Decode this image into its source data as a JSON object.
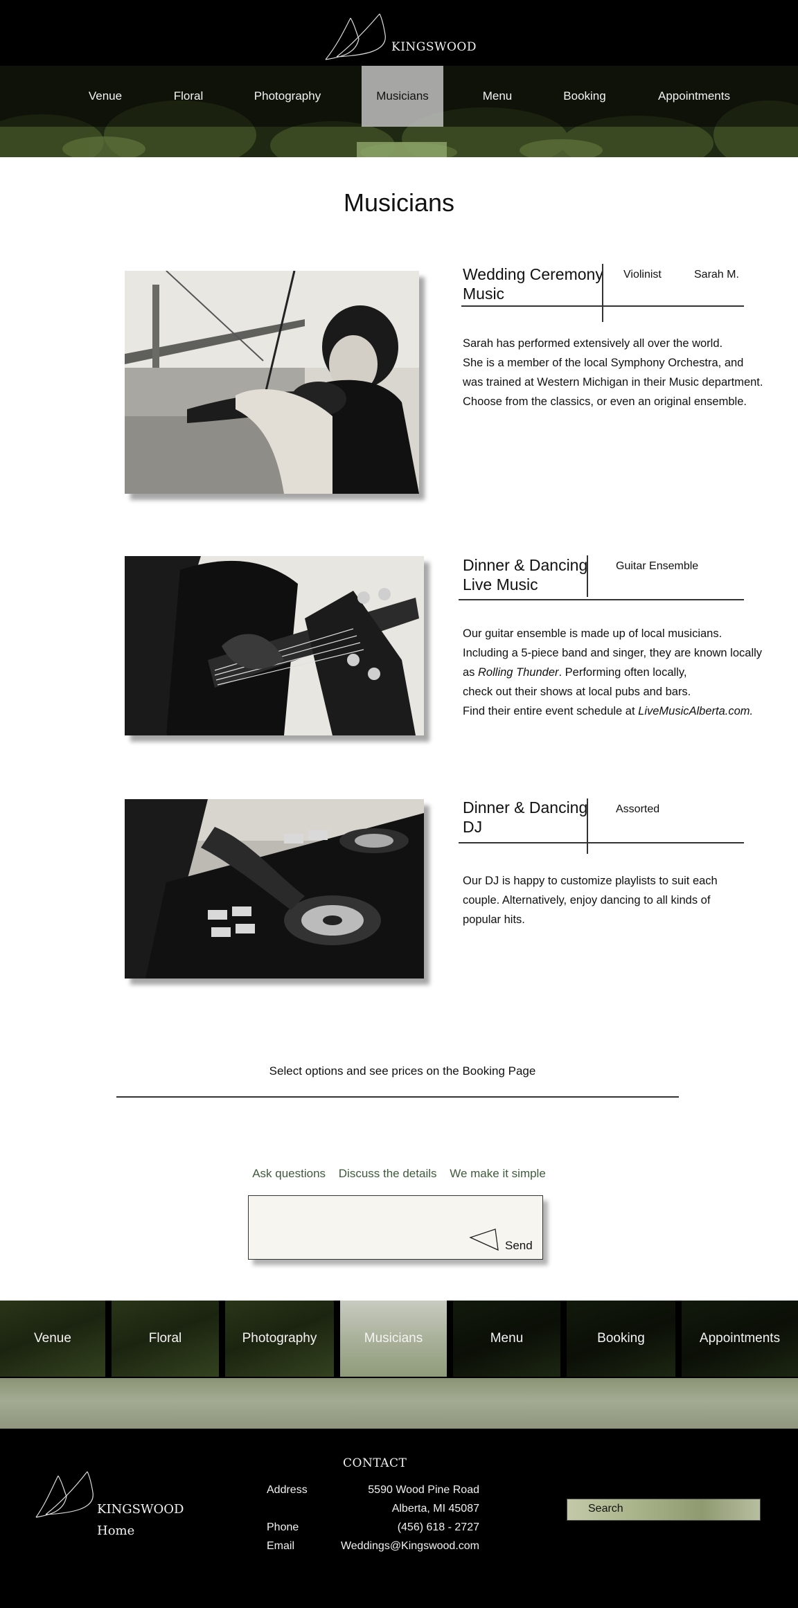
{
  "brand": {
    "name": "KINGSWOOD",
    "home_label": "Home"
  },
  "nav": {
    "items": [
      "Venue",
      "Floral",
      "Photography",
      "Musicians",
      "Menu",
      "Booking",
      "Appointments"
    ],
    "active": "Musicians"
  },
  "page": {
    "title": "Musicians"
  },
  "sections": [
    {
      "title_line1": "Wedding Ceremony",
      "title_line2": "Music",
      "meta1": "Violinist",
      "meta2": "Sarah M.",
      "body": [
        "Sarah has performed extensively all over the world.",
        "She is a member of the local Symphony Orchestra, and",
        "was trained at Western Michigan in their Music department.",
        "Choose from the classics, or even an original ensemble."
      ],
      "image": "violinist-photo"
    },
    {
      "title_line1": "Dinner & Dancing",
      "title_line2": "Live Music",
      "meta1": "Guitar Ensemble",
      "body_line1": "Our guitar ensemble is made up of local musicians.",
      "body_line2": "Including a 5-piece band and singer, they are known locally",
      "body_line3_pre": "as ",
      "body_line3_em": "Rolling Thunder",
      "body_line3_post": ". Performing often locally,",
      "body_line4": "check out their shows at local pubs and bars.",
      "body_line5_pre": "Find their entire event schedule at ",
      "body_line5_em": "LiveMusicAlberta.com.",
      "image": "bass-guitar-photo"
    },
    {
      "title_line1": "Dinner & Dancing",
      "title_line2": "DJ",
      "meta1": "Assorted",
      "body": [
        "Our DJ is happy to customize playlists to suit each",
        "couple. Alternatively, enjoy dancing to all kinds of",
        "popular hits."
      ],
      "image": "dj-controller-photo"
    }
  ],
  "booking_note": "Select options and see prices on the Booking Page",
  "contact_form": {
    "tags": [
      "Ask questions",
      "Discuss the details",
      "We make it simple"
    ],
    "message_value": "",
    "send_label": "Send",
    "send_icon": "paper-plane-icon"
  },
  "footer": {
    "contact_heading": "CONTACT",
    "address_label": "Address",
    "address_line1": "5590 Wood Pine Road",
    "address_line2": "Alberta, MI 45087",
    "phone_label": "Phone",
    "phone": "(456) 618 - 2727",
    "email_label": "Email",
    "email": "Weddings@Kingswood.com",
    "search_label": "Search"
  },
  "colors": {
    "header_bg": "#000000",
    "accent_green": "#3e5a3b",
    "active_tab": "#c8c8c8",
    "form_bg": "#f7f5f0"
  }
}
